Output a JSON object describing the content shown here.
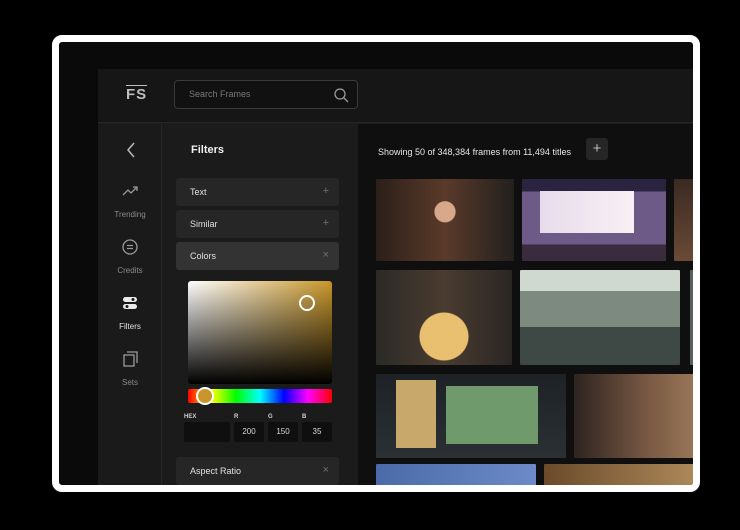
{
  "app": {
    "logo": "FS"
  },
  "search": {
    "placeholder": "Search Frames"
  },
  "sidebar": {
    "items": [
      {
        "label": "Trending",
        "icon": "trending-icon"
      },
      {
        "label": "Credits",
        "icon": "credits-icon"
      },
      {
        "label": "Filters",
        "icon": "filters-icon",
        "active": true
      },
      {
        "label": "Sets",
        "icon": "sets-icon"
      }
    ]
  },
  "filters": {
    "title": "Filters",
    "rows": [
      {
        "label": "Text",
        "toggle": "+"
      },
      {
        "label": "Similar",
        "toggle": "+"
      },
      {
        "label": "Colors",
        "toggle": "×",
        "open": true
      },
      {
        "label": "Aspect Ratio",
        "toggle": "×"
      }
    ],
    "color": {
      "selected_hex": "#c8962a",
      "labels": {
        "hex": "HEX",
        "r": "R",
        "g": "G",
        "b": "B"
      },
      "hex_value": "",
      "r": "200",
      "g": "150",
      "b": "35"
    }
  },
  "results": {
    "summary": "Showing 50 of 348,384 frames from 11,494 titles",
    "add_label": "+"
  }
}
